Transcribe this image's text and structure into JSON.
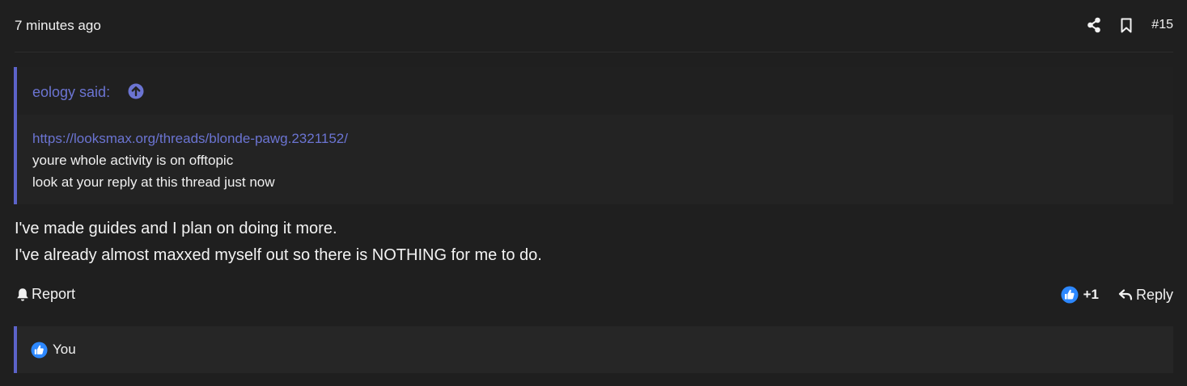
{
  "post": {
    "timestamp": "7 minutes ago",
    "number": "#15",
    "icons": {
      "share": "share-icon",
      "bookmark": "bookmark-icon"
    }
  },
  "quote": {
    "author_label": "eology said:",
    "jump_icon": "arrow-up-circle-icon",
    "link": "https://looksmax.org/threads/blonde-pawg.2321152/",
    "lines": [
      "youre whole activity is on offtopic",
      "look at your reply at this thread just now"
    ]
  },
  "message": {
    "lines": [
      "I've made guides and I plan on doing it more.",
      "I've already almost maxxed myself out so there is NOTHING for me to do."
    ]
  },
  "footer": {
    "report_label": "Report",
    "reaction_count": "+1",
    "reply_label": "Reply",
    "icons": {
      "report": "bell-icon",
      "like": "thumbs-up-icon",
      "reply": "reply-arrow-icon"
    }
  },
  "reactions": {
    "likers": "You"
  },
  "colors": {
    "accent": "#5c63c9",
    "link": "#6b74d2",
    "like_blue": "#2d88ff",
    "background": "#1f1f1f"
  }
}
